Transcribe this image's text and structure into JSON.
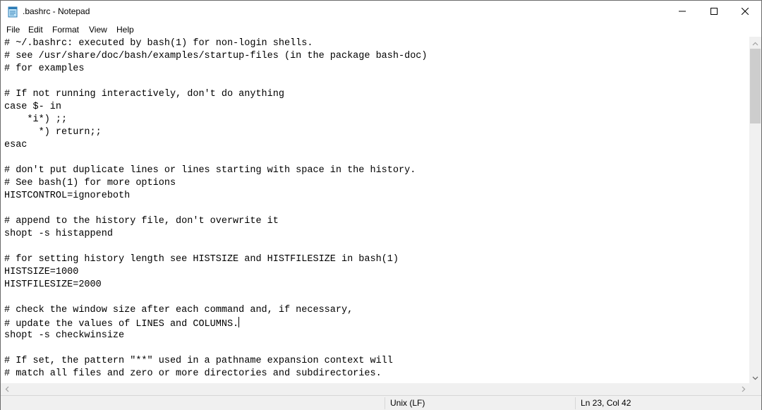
{
  "window": {
    "title": ".bashrc - Notepad"
  },
  "icons": {
    "app": "notepad-icon",
    "minimize": "minimize-icon",
    "maximize": "maximize-icon",
    "close": "close-icon"
  },
  "menu": {
    "items": [
      "File",
      "Edit",
      "Format",
      "View",
      "Help"
    ]
  },
  "editor": {
    "lines": [
      "# ~/.bashrc: executed by bash(1) for non-login shells.",
      "# see /usr/share/doc/bash/examples/startup-files (in the package bash-doc)",
      "# for examples",
      "",
      "# If not running interactively, don't do anything",
      "case $- in",
      "    *i*) ;;",
      "      *) return;;",
      "esac",
      "",
      "# don't put duplicate lines or lines starting with space in the history.",
      "# See bash(1) for more options",
      "HISTCONTROL=ignoreboth",
      "",
      "# append to the history file, don't overwrite it",
      "shopt -s histappend",
      "",
      "# for setting history length see HISTSIZE and HISTFILESIZE in bash(1)",
      "HISTSIZE=1000",
      "HISTFILESIZE=2000",
      "",
      "# check the window size after each command and, if necessary,",
      "# update the values of LINES and COLUMNS.",
      "shopt -s checkwinsize",
      "",
      "# If set, the pattern \"**\" used in a pathname expansion context will",
      "# match all files and zero or more directories and subdirectories."
    ],
    "caret_line": 23,
    "caret_col": 42
  },
  "status": {
    "line_ending": "Unix (LF)",
    "position": "Ln 23, Col 42"
  }
}
